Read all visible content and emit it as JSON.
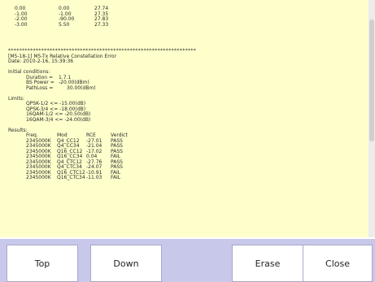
{
  "top_rows": [
    [
      "0.00",
      "0.00",
      "27.74"
    ],
    [
      "-1.00",
      "-1.00",
      "27.35"
    ],
    [
      "-2.00",
      "-90.00",
      "27.83"
    ],
    [
      "-3.00",
      "5.50",
      "27.33"
    ]
  ],
  "separator": "********************************************************************",
  "test": {
    "id_line": "[M5-18-1] M5-Tx Relative Constellation Error",
    "date_line": "Date: 2010-2-16, 15:39:36"
  },
  "initial": {
    "heading": "Initial conditions:",
    "items": [
      {
        "label": "Duration =",
        "value": "1.7.1"
      },
      {
        "label": "BS Power =",
        "value": "-20.00(dBm)"
      },
      {
        "label": "PathLoss =",
        "value": "30.00(dBm)"
      }
    ]
  },
  "limits": {
    "heading": "Limits:",
    "items": [
      "QPSK-1/2 <= -15.00(dB)",
      "QPSK-3/4 <= -18.00(dB)",
      "16QAM-1/2 <= -20.50(dB)",
      "16QAM-3/4 <= -24.00(dB)"
    ]
  },
  "results": {
    "heading": "Results:",
    "columns": [
      "Freq.",
      "Mod",
      "RCE",
      "Verdict"
    ],
    "rows": [
      [
        "2345000K",
        "Q4_CC12",
        "-27.01",
        "PASS"
      ],
      [
        "2345000K",
        "Q4_CC34",
        "-21.04",
        "PASS"
      ],
      [
        "2345000K",
        "Q16_CC12",
        "-17.02",
        "PASS"
      ],
      [
        "2345000K",
        "Q16_CC34",
        "0.04",
        "FAIL"
      ],
      [
        "2345000K",
        "Q4_CTC12",
        "-27.76",
        "PASS"
      ],
      [
        "2345000K",
        "Q4_CTC34",
        "-24.07",
        "PASS"
      ],
      [
        "2345000K",
        "Q16_CTC12",
        "-10.91",
        "FAIL"
      ],
      [
        "2345000K",
        "Q16_CTC34",
        "-11.03",
        "FAIL"
      ]
    ]
  },
  "buttons": {
    "top": "Top",
    "down": "Down",
    "erase": "Erase",
    "close": "Close"
  }
}
